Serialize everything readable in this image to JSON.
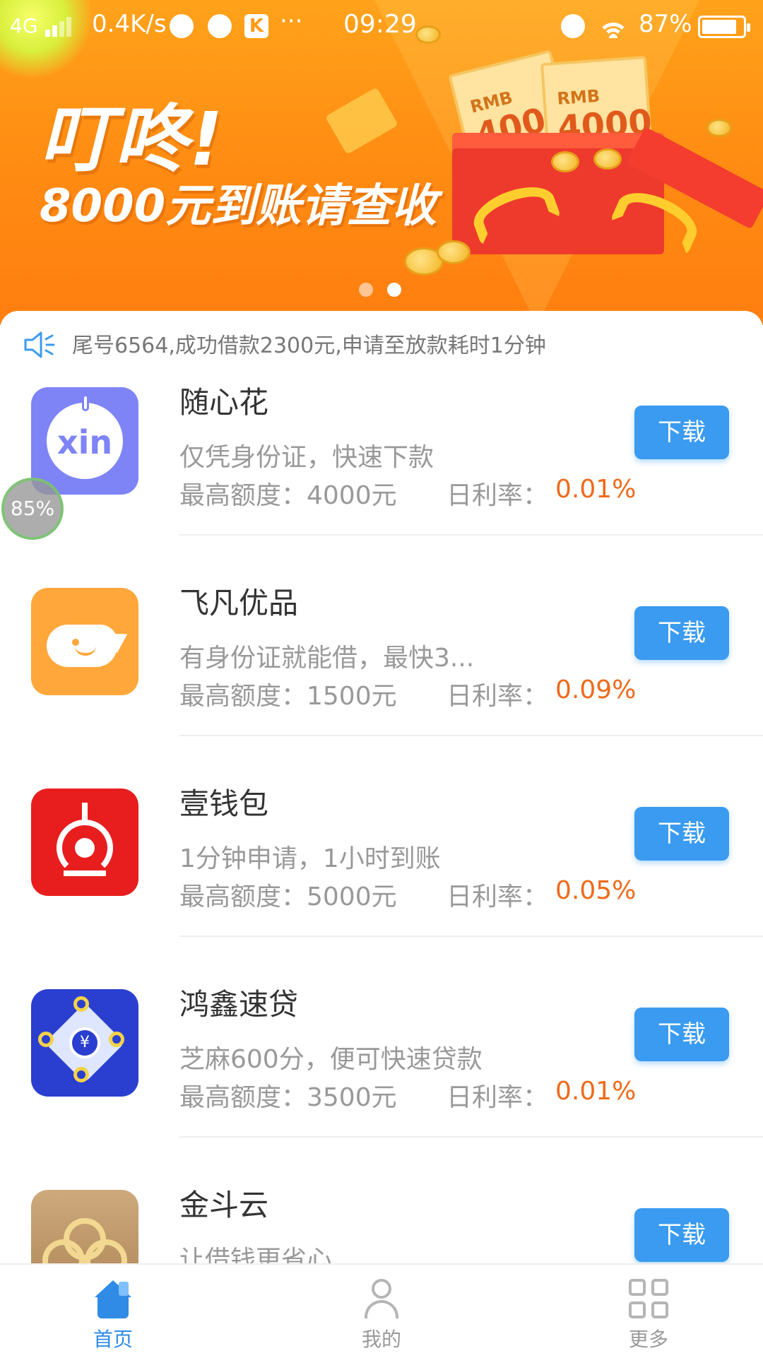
{
  "status_bar": {
    "network": "4G",
    "speed": "0.4K/s",
    "app_icon_letter": "K",
    "more": "···",
    "time": "09:29",
    "battery": "87%"
  },
  "banner": {
    "headline_1": "叮咚!",
    "headline_2": "8000元到账请查收",
    "ticket_currency": "RMB",
    "ticket_amount_1": "4000",
    "ticket_amount_2": "4000",
    "page_count": 2,
    "active_page": 2
  },
  "notice": {
    "text": "尾号6564,成功借款2300元,申请至放款耗时1分钟"
  },
  "overlay_badge": "85%",
  "list": {
    "items": [
      {
        "name": "随心花",
        "logo": "xin",
        "logo_text": "xin",
        "desc": "仅凭身份证，快速下款",
        "limit": "最高额度：4000元",
        "rate_label": "日利率：",
        "rate": "0.01%",
        "button": "下载"
      },
      {
        "name": "飞凡优品",
        "logo": "whale",
        "desc": "有身份证就能借，最快3...",
        "limit": "最高额度：1500元",
        "rate_label": "日利率：",
        "rate": "0.09%",
        "button": "下载"
      },
      {
        "name": "壹钱包",
        "logo": "yiqianbao",
        "desc": "1分钟申请，1小时到账",
        "limit": "最高额度：5000元",
        "rate_label": "日利率：",
        "rate": "0.05%",
        "button": "下载"
      },
      {
        "name": "鸿鑫速贷",
        "logo": "hongxin",
        "logo_text": "¥",
        "desc": "芝麻600分，便可快速贷款",
        "limit": "最高额度：3500元",
        "rate_label": "日利率：",
        "rate": "0.01%",
        "button": "下载"
      },
      {
        "name": "金斗云",
        "logo": "jindouyun",
        "desc": "让借钱更省心",
        "button": "下载"
      }
    ]
  },
  "tabbar": {
    "tabs": [
      {
        "label": "首页",
        "icon": "home-icon",
        "active": true
      },
      {
        "label": "我的",
        "icon": "user-icon",
        "active": false
      },
      {
        "label": "更多",
        "icon": "grid-icon",
        "active": false
      }
    ]
  },
  "colors": {
    "accent_blue": "#3a9bf0",
    "rate_orange": "#ee6a1b",
    "banner_orange": "#ff8a12",
    "tab_active": "#2f8be6"
  }
}
